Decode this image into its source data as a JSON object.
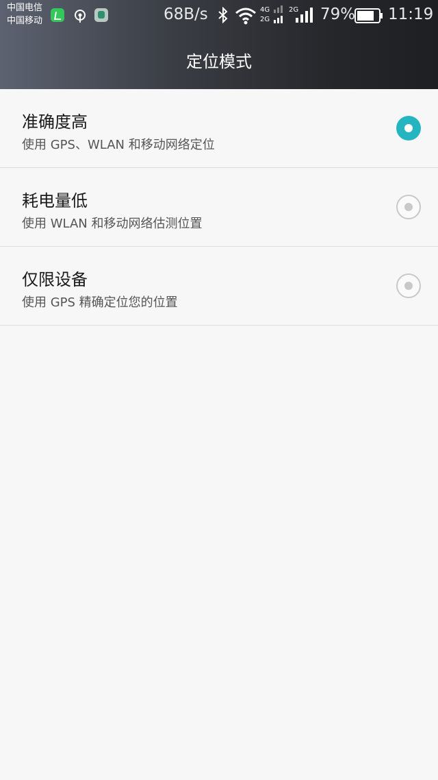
{
  "status_bar": {
    "carrier_1": "中国电信",
    "carrier_2": "中国移动",
    "net_speed": "68B/s",
    "signal_1_labels": [
      "4G",
      "2G"
    ],
    "signal_2_label": "2G",
    "battery_percent": "79%",
    "time": "11:19",
    "icons": [
      "app-notification-icon",
      "hotspot-icon",
      "app-notification-icon",
      "bluetooth-icon",
      "wifi-icon",
      "cellular-signal-icon",
      "cellular-signal-icon",
      "battery-icon"
    ]
  },
  "header": {
    "title": "定位模式"
  },
  "options": [
    {
      "title": "准确度高",
      "subtitle": "使用 GPS、WLAN 和移动网络定位",
      "selected": true
    },
    {
      "title": "耗电量低",
      "subtitle": "使用 WLAN 和移动网络估测位置",
      "selected": false
    },
    {
      "title": "仅限设备",
      "subtitle": "使用 GPS 精确定位您的位置",
      "selected": false
    }
  ],
  "colors": {
    "accent": "#25b5c0",
    "background": "#f7f7f7",
    "header_dark": "#1e1f22"
  }
}
